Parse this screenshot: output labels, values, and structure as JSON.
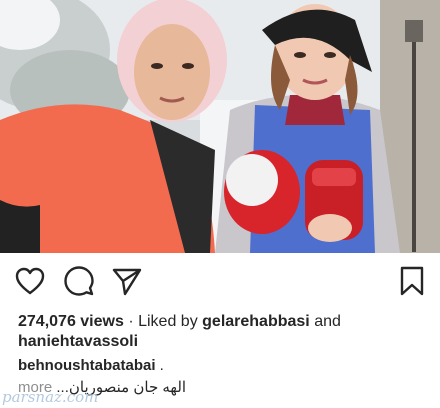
{
  "post": {
    "views": "274,076 views",
    "liked_prefix": " · Liked by ",
    "liked_user_1": "gelarehabbasi",
    "liked_and": " and",
    "liked_user_2": "haniehtavassoli",
    "caption_user": "behnoushtabatabai",
    "caption_sep": " .",
    "more_label": "more",
    "caption_text": "الهه جان منصوریان..."
  },
  "watermark": "parsnaz.com",
  "icons": {
    "like": "heart-icon",
    "comment": "comment-icon",
    "share": "share-icon",
    "save": "bookmark-icon"
  },
  "colors": {
    "text": "#262626",
    "muted": "#8e8e8e",
    "jacket_orange": "#f26b4f",
    "vest_blue": "#4f6fcf",
    "glove_red": "#d8242b"
  }
}
